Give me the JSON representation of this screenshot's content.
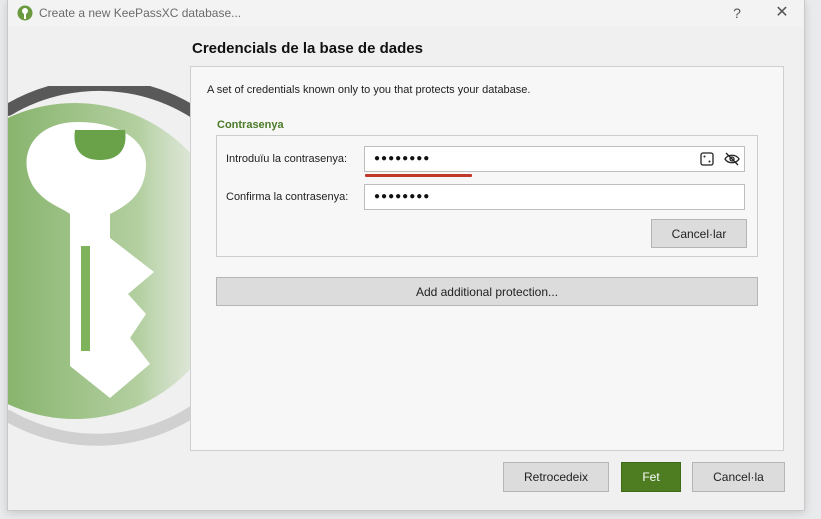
{
  "window": {
    "title": "Create a new KeePassXC database...",
    "help_label": "?",
    "close_label": "✕"
  },
  "page": {
    "heading": "Credencials de la base de dades",
    "description": "A set of credentials known only to you that protects your database."
  },
  "password_group": {
    "title": "Contrasenya",
    "enter_label": "Introduïu la contrasenya:",
    "enter_value": "●●●●●●●●",
    "confirm_label": "Confirma la contrasenya:",
    "confirm_value": "●●●●●●●●",
    "cancel_label": "Cancel·lar",
    "strength_color": "#c0392b",
    "field_icons": [
      "password-generator-icon",
      "toggle-visibility-icon"
    ]
  },
  "add_protection_label": "Add additional protection...",
  "footer": {
    "back_label": "Retrocedeix",
    "done_label": "Fet",
    "cancel_label": "Cancel·la"
  },
  "colors": {
    "accent": "#4e7d21",
    "group_title": "#4b7a28"
  }
}
